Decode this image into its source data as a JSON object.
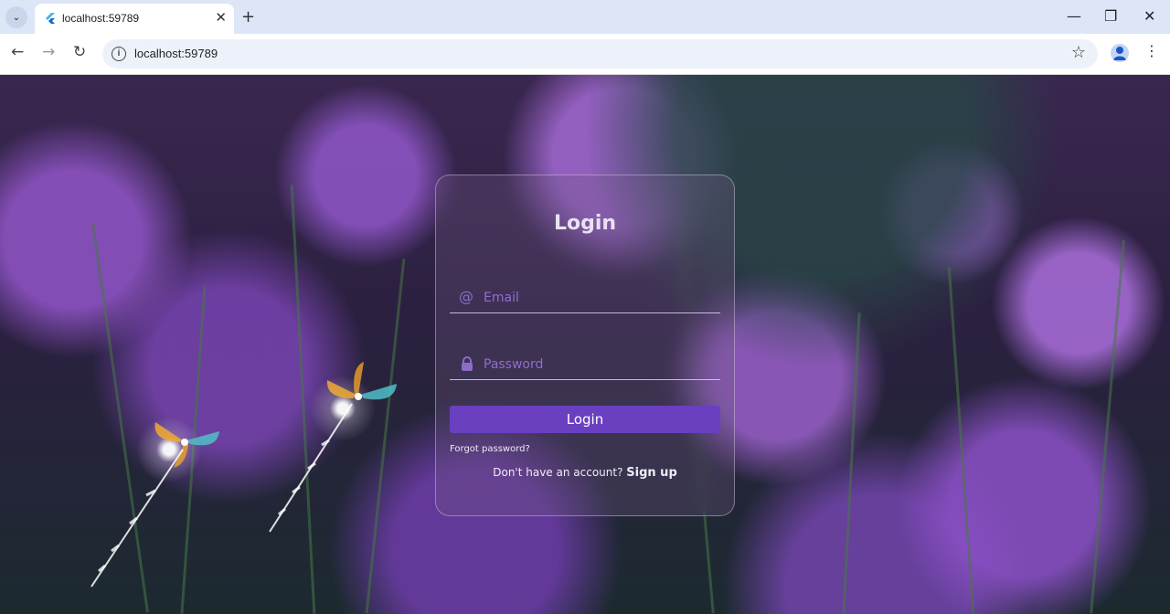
{
  "browser": {
    "tab": {
      "title": "localhost:59789"
    },
    "address": "localhost:59789"
  },
  "login": {
    "title": "Login",
    "email_placeholder": "Email",
    "password_placeholder": "Password",
    "button_label": "Login",
    "forgot_label": "Forgot password?",
    "signup_prompt": "Don't have an account?",
    "signup_link": "Sign up"
  },
  "colors": {
    "accent": "#6a3fc0",
    "placeholder": "#8f6ed0",
    "tabbar": "#dce6f7"
  }
}
